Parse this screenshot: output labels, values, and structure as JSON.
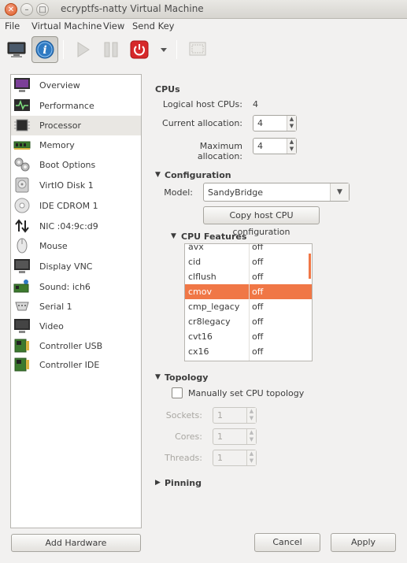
{
  "window": {
    "title": "ecryptfs-natty Virtual Machine"
  },
  "menubar": {
    "items": [
      "File",
      "Virtual Machine",
      "View",
      "Send Key"
    ]
  },
  "toolbar": {
    "buttons": [
      "console-icon",
      "details-info-icon",
      "run-icon",
      "pause-icon",
      "shutdown-icon",
      "shutdown-dropdown-icon",
      "fullscreen-icon"
    ]
  },
  "sidebar": {
    "items": [
      {
        "label": "Overview",
        "icon": "overview-icon"
      },
      {
        "label": "Performance",
        "icon": "performance-icon"
      },
      {
        "label": "Processor",
        "icon": "processor-icon",
        "selected": true
      },
      {
        "label": "Memory",
        "icon": "memory-icon"
      },
      {
        "label": "Boot Options",
        "icon": "boot-options-icon"
      },
      {
        "label": "VirtIO Disk 1",
        "icon": "disk-icon"
      },
      {
        "label": "IDE CDROM 1",
        "icon": "cdrom-icon"
      },
      {
        "label": "NIC :04:9c:d9",
        "icon": "network-icon"
      },
      {
        "label": "Mouse",
        "icon": "mouse-icon"
      },
      {
        "label": "Display VNC",
        "icon": "display-icon"
      },
      {
        "label": "Sound: ich6",
        "icon": "sound-icon"
      },
      {
        "label": "Serial 1",
        "icon": "serial-icon"
      },
      {
        "label": "Video",
        "icon": "video-icon"
      },
      {
        "label": "Controller USB",
        "icon": "controller-icon"
      },
      {
        "label": "Controller IDE",
        "icon": "controller-icon"
      }
    ],
    "add_hardware": "Add Hardware"
  },
  "cpus": {
    "heading": "CPUs",
    "logical_label": "Logical host CPUs:",
    "logical_value": "4",
    "current_label": "Current allocation:",
    "current_value": "4",
    "max_label": "Maximum allocation:",
    "max_value": "4"
  },
  "configuration": {
    "heading": "Configuration",
    "model_label": "Model:",
    "model_value": "SandyBridge",
    "copy_button": "Copy host CPU configuration",
    "features_heading": "CPU Features",
    "features": [
      {
        "name": "avx",
        "value": "off"
      },
      {
        "name": "cid",
        "value": "off"
      },
      {
        "name": "clflush",
        "value": "off"
      },
      {
        "name": "cmov",
        "value": "off",
        "selected": true
      },
      {
        "name": "cmp_legacy",
        "value": "off"
      },
      {
        "name": "cr8legacy",
        "value": "off"
      },
      {
        "name": "cvt16",
        "value": "off"
      },
      {
        "name": "cx16",
        "value": "off"
      }
    ]
  },
  "topology": {
    "heading": "Topology",
    "manual_label": "Manually set CPU topology",
    "manual_checked": false,
    "sockets_label": "Sockets:",
    "sockets_value": "1",
    "cores_label": "Cores:",
    "cores_value": "1",
    "threads_label": "Threads:",
    "threads_value": "1"
  },
  "pinning": {
    "heading": "Pinning"
  },
  "footer": {
    "cancel": "Cancel",
    "apply": "Apply"
  },
  "colors": {
    "accent": "#f07746",
    "close_button": "#df5f2a",
    "info_button": "#2f7ac2",
    "shutdown_button": "#d6282a"
  }
}
